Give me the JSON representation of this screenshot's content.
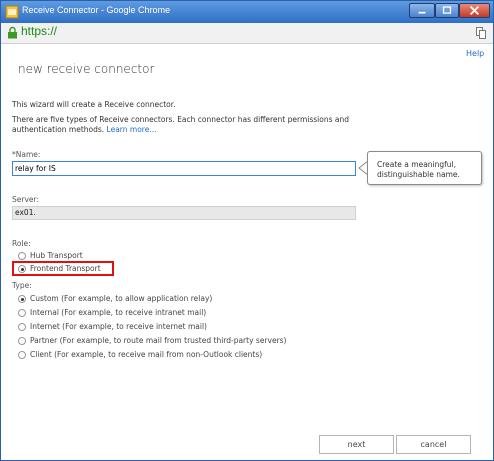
{
  "window": {
    "title": "Receive Connector - Google Chrome",
    "url": "https://"
  },
  "page": {
    "help_label": "Help",
    "title": "new receive connector",
    "intro1": "This wizard will create a Receive connector.",
    "intro2_line1": "There are five types of Receive connectors. Each connector has different permissions and",
    "intro2_line2_text": "authentication methods. ",
    "learn_more": "Learn more..."
  },
  "name_field": {
    "label": "*Name:",
    "value": "relay for IS"
  },
  "callout": {
    "text": "Create a meaningful,\ndistinguishable name."
  },
  "server_field": {
    "label": "Server:",
    "value": "ex01."
  },
  "role": {
    "label": "Role:",
    "options": [
      {
        "label": "Hub Transport",
        "checked": false
      },
      {
        "label": "Frontend Transport",
        "checked": true
      }
    ]
  },
  "type": {
    "label": "Type:",
    "options": [
      {
        "label": "Custom (For example, to allow application relay)",
        "checked": true
      },
      {
        "label": "Internal (For example, to receive intranet mail)",
        "checked": false
      },
      {
        "label": "Internet (For example, to receive internet mail)",
        "checked": false
      },
      {
        "label": "Partner (For example, to route mail from trusted third-party servers)",
        "checked": false
      },
      {
        "label": "Client (For example, to receive mail from non-Outlook clients)",
        "checked": false
      }
    ]
  },
  "buttons": {
    "next": "next",
    "cancel": "cancel"
  },
  "colors": {
    "titlebar": "#2f6fc4",
    "link": "#1f6fc5",
    "highlight": "#e01010",
    "secure_url": "#1a8a1a"
  },
  "icons": {
    "app": "chrome-app-icon",
    "lock": "lock-icon",
    "page": "page-menu-icon",
    "minimize": "minimize-icon",
    "maximize": "maximize-icon",
    "close": "close-icon"
  }
}
